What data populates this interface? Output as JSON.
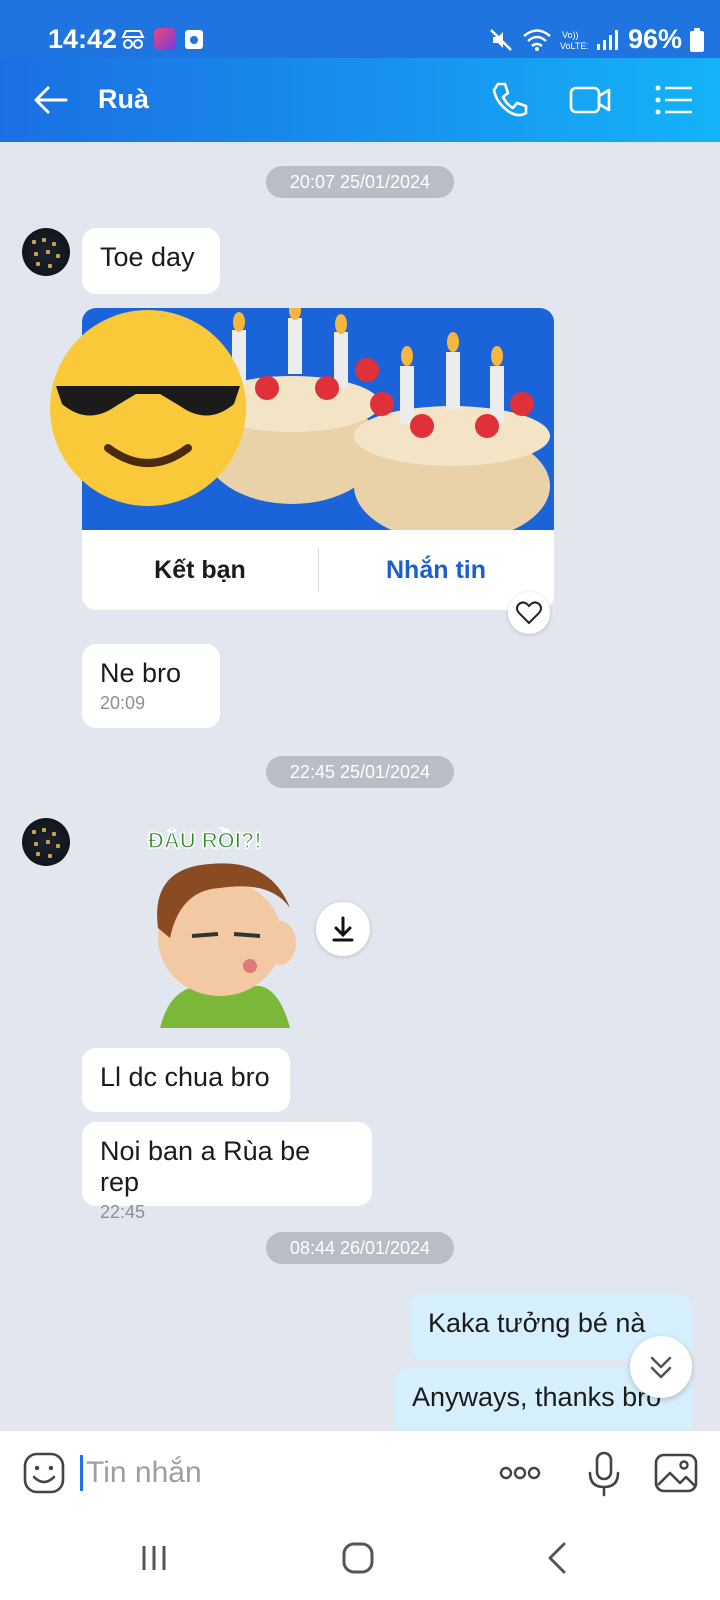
{
  "status_bar": {
    "time": "14:42",
    "network_badge": "VoLTE1",
    "battery_percent": "96%"
  },
  "header": {
    "contact_name": "Ruà"
  },
  "messages": {
    "date_1": "20:07 25/01/2024",
    "m1_text": "Toe day",
    "card_add_friend": "Kết bạn",
    "card_message": "Nhắn tin",
    "m2_text": "Ne bro",
    "m2_time": "20:09",
    "date_2": "22:45 25/01/2024",
    "sticker_text": "ĐÂU RỒI?!",
    "m3_text": "Ll dc chua bro",
    "m4_text": "Noi ban a Rùa be rep",
    "m4_time": "22:45",
    "date_3": "08:44 26/01/2024",
    "m5_text": "Kaka tưởng bé nà",
    "m6_text": "Anyways, thanks bro"
  },
  "input": {
    "placeholder": "Tin nhắn"
  },
  "icons": {
    "back": "arrow-left-icon",
    "call": "phone-icon",
    "video": "video-camera-icon",
    "menu": "list-menu-icon",
    "emoji": "sticker-smile-icon",
    "more": "more-dots-icon",
    "mic": "microphone-icon",
    "image": "image-gallery-icon",
    "download": "download-icon",
    "heart": "heart-icon",
    "scroll": "chevron-double-down-icon"
  },
  "colors": {
    "header_start": "#1b6fe3",
    "header_end": "#14b3f7",
    "chat_bg": "#e2e7ef",
    "my_bubble": "#d6effd",
    "accent_link": "#1a5fd0"
  }
}
